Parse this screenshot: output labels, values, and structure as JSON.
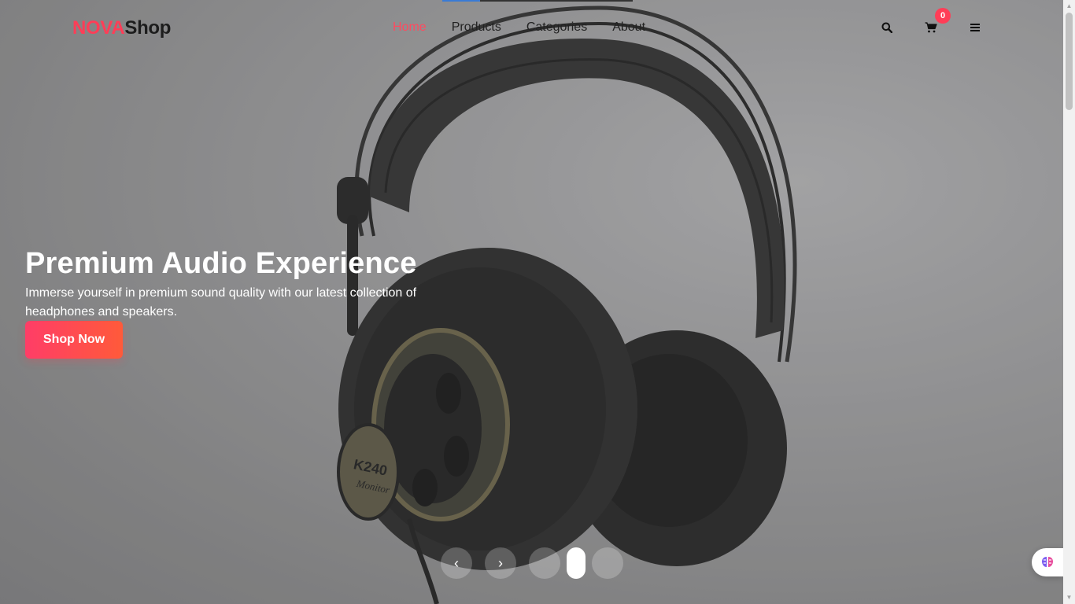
{
  "header": {
    "logo_part1": "NOVA",
    "logo_part2": "Shop",
    "nav": [
      {
        "label": "Home",
        "active": true
      },
      {
        "label": "Products",
        "active": false
      },
      {
        "label": "Categories",
        "active": false
      },
      {
        "label": "About",
        "active": false
      }
    ],
    "cart_count": "0",
    "icons": {
      "search": "search-icon",
      "cart": "cart-icon",
      "menu": "menu-icon"
    }
  },
  "hero": {
    "title": "Premium Audio Experience",
    "description": "Immerse yourself in premium sound quality with our latest collection of headphones and speakers.",
    "cta_label": "Shop Now",
    "product_text_1": "K240",
    "product_text_2": "Monitor"
  },
  "carousel": {
    "prev_label": "‹",
    "next_label": "›",
    "slide_count": 3,
    "active_slide": 2
  },
  "colors": {
    "accent": "#ff3d57",
    "cta_gradient_start": "#ff3d67",
    "cta_gradient_end": "#ff5a3a"
  }
}
